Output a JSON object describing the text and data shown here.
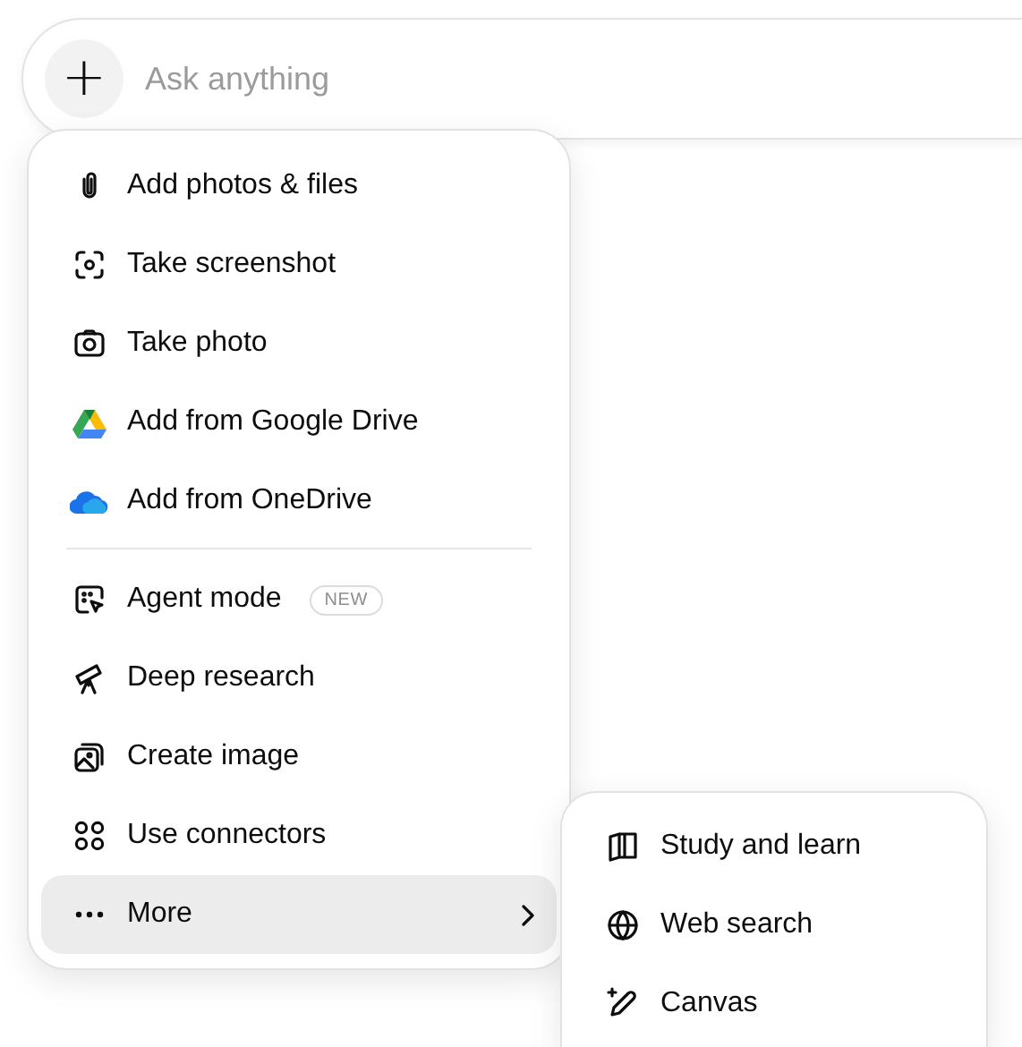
{
  "composer": {
    "placeholder": "Ask anything",
    "add_button": "+"
  },
  "menu": {
    "groups": [
      {
        "items": [
          {
            "label": "Add photos & files",
            "selected": false
          },
          {
            "label": "Take screenshot",
            "selected": false
          },
          {
            "label": "Take photo",
            "selected": false
          },
          {
            "label": "Add from Google Drive",
            "selected": false
          },
          {
            "label": "Add from OneDrive",
            "selected": false
          }
        ]
      },
      {
        "items": [
          {
            "label": "Agent mode",
            "badge": "NEW",
            "selected": false
          },
          {
            "label": "Deep research",
            "selected": false
          },
          {
            "label": "Create image",
            "selected": false
          },
          {
            "label": "Use connectors",
            "selected": false
          },
          {
            "label": "More",
            "selected": true,
            "submenu": true
          }
        ]
      }
    ]
  },
  "submenu": {
    "items": [
      {
        "label": "Study and learn",
        "selected": false
      },
      {
        "label": "Web search",
        "selected": false
      },
      {
        "label": "Canvas",
        "selected": false
      }
    ]
  }
}
